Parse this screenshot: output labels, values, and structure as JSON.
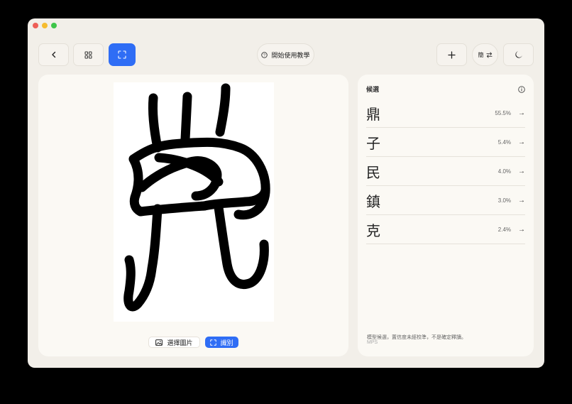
{
  "window": {
    "traffic_colors": [
      "#ee5f57",
      "#f6bc2f",
      "#3fc54a"
    ]
  },
  "toolbar": {
    "back_icon": "chevron-left-icon",
    "grid_icon": "grid-icon",
    "recognize_icon": "scan-frame-icon",
    "tutorial_label": "開始使用教學",
    "add_icon": "plus-icon",
    "script_toggle_label": "簡",
    "moon_icon": "moon-icon",
    "accent": "#2f6df5"
  },
  "left": {
    "select_image_label": "選擇圖片",
    "recognize_label": "識別"
  },
  "candidates": {
    "title": "候選",
    "items": [
      {
        "char": "鼎",
        "pct": "55.5%"
      },
      {
        "char": "子",
        "pct": "5.4%"
      },
      {
        "char": "民",
        "pct": "4.0%"
      },
      {
        "char": "鎮",
        "pct": "3.0%"
      },
      {
        "char": "克",
        "pct": "2.4%"
      }
    ],
    "note": "模型候選，置信度未經校準，不是確定釋讀。",
    "footer": "MPS"
  }
}
